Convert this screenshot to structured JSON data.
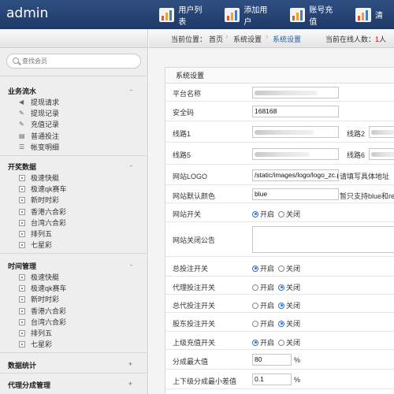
{
  "app": {
    "title": "admin"
  },
  "topnav": [
    {
      "label": "用户列表",
      "icon": "chart-icon"
    },
    {
      "label": "添加用户",
      "icon": "chart-icon"
    },
    {
      "label": "账号充值",
      "icon": "chart-icon"
    },
    {
      "label": "清",
      "icon": "chart-icon"
    }
  ],
  "search": {
    "placeholder": "查找会员"
  },
  "sidebar": {
    "groups": [
      {
        "title": "业务流水",
        "toggle": "-",
        "items": [
          {
            "label": "提现请求",
            "icon": "speaker-icon"
          },
          {
            "label": "提现记录",
            "icon": "edit-icon"
          },
          {
            "label": "充值记录",
            "icon": "edit-icon"
          },
          {
            "label": "普通投注",
            "icon": "document-icon"
          },
          {
            "label": "帐变明细",
            "icon": "list-icon"
          }
        ]
      },
      {
        "title": "开奖数据",
        "toggle": "-",
        "items": [
          {
            "label": "极速快艇",
            "icon": "box-icon"
          },
          {
            "label": "极速qk赛车",
            "icon": "box-icon"
          },
          {
            "label": "新时时彩",
            "icon": "box-icon"
          },
          {
            "label": "香港六合彩",
            "icon": "box-icon"
          },
          {
            "label": "台湾六合彩",
            "icon": "box-icon"
          },
          {
            "label": "排列五",
            "icon": "box-icon"
          },
          {
            "label": "七星彩",
            "icon": "box-icon"
          }
        ]
      },
      {
        "title": "时间管理",
        "toggle": "-",
        "items": [
          {
            "label": "极速快艇",
            "icon": "box-icon"
          },
          {
            "label": "极速qk赛车",
            "icon": "box-icon"
          },
          {
            "label": "新时时彩",
            "icon": "box-icon"
          },
          {
            "label": "香港六合彩",
            "icon": "box-icon"
          },
          {
            "label": "台湾六合彩",
            "icon": "box-icon"
          },
          {
            "label": "排列五",
            "icon": "box-icon"
          },
          {
            "label": "七星彩",
            "icon": "box-icon"
          }
        ]
      },
      {
        "title": "数据统计",
        "toggle": "+",
        "items": []
      },
      {
        "title": "代理分成管理",
        "toggle": "+",
        "items": []
      }
    ]
  },
  "breadcrumb": {
    "prefix": "当前位置：",
    "items": [
      "首页",
      "系统设置",
      "系统设置"
    ],
    "online_label": "当前在线人数：",
    "online_count": "1",
    "online_unit": "人"
  },
  "panel": {
    "title": "系统设置",
    "fields": {
      "site_name": {
        "label": "平台名称",
        "value": ""
      },
      "security_code": {
        "label": "安全码",
        "value": "168168"
      },
      "line1": {
        "label": "线路1",
        "value": ""
      },
      "line2": {
        "label": "线路2",
        "value": ""
      },
      "line5": {
        "label": "线路5",
        "value": ""
      },
      "line6": {
        "label": "线路6",
        "value": ""
      },
      "logo": {
        "label": "网站LOGO",
        "value": "/static/images/logo/logo_zc.png",
        "hint": "请填写具体地址"
      },
      "color": {
        "label": "网站默认颜色",
        "value": "blue",
        "hint": "暂只支持blue和re"
      },
      "site_switch": {
        "label": "网站开关",
        "options": [
          "开启",
          "关闭"
        ],
        "selected": "开启"
      },
      "close_notice": {
        "label": "网站关闭公告",
        "value": ""
      },
      "bet_switch": {
        "label": "总投注开关",
        "options": [
          "开启",
          "关闭"
        ],
        "selected": "开启"
      },
      "agent_bet_switch": {
        "label": "代理投注开关",
        "options": [
          "开启",
          "关闭"
        ],
        "selected": "关闭"
      },
      "general_agent_switch": {
        "label": "总代投注开关",
        "options": [
          "开启",
          "关闭"
        ],
        "selected": "关闭"
      },
      "shareholder_switch": {
        "label": "股东投注开关",
        "options": [
          "开启",
          "关闭"
        ],
        "selected": "关闭"
      },
      "recharge_switch": {
        "label": "上级充值开关",
        "options": [
          "开启",
          "关闭"
        ],
        "selected": "开启"
      },
      "max_share": {
        "label": "分成最大值",
        "value": "80",
        "unit": "%"
      },
      "min_diff": {
        "label": "上下级分成最小差值",
        "value": "0.1",
        "unit": "%"
      }
    }
  }
}
